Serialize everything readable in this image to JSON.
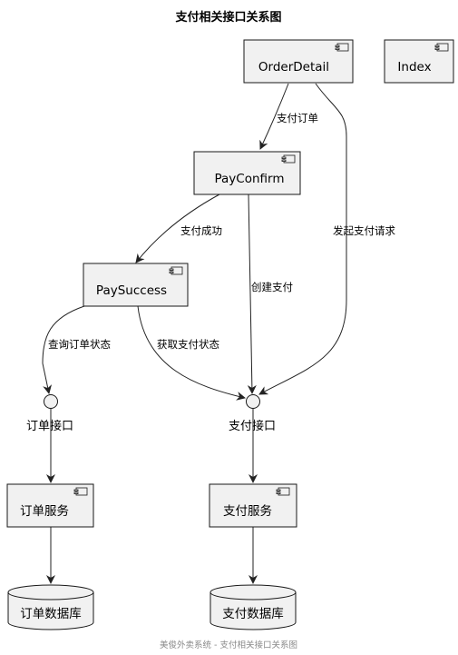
{
  "title": "支付相关接口关系图",
  "footer": "美俊外卖系统 - 支付相关接口关系图",
  "nodes": {
    "order_detail": "OrderDetail",
    "index": "Index",
    "pay_confirm": "PayConfirm",
    "pay_success": "PaySuccess",
    "order_service": "订单服务",
    "pay_service": "支付服务"
  },
  "interfaces": {
    "order_api": "订单接口",
    "pay_api": "支付接口"
  },
  "databases": {
    "order_db": "订单数据库",
    "pay_db": "支付数据库"
  },
  "edges": {
    "detail_to_confirm": "支付订单",
    "confirm_to_success": "支付成功",
    "detail_to_payapi": "发起支付请求",
    "confirm_to_payapi": "创建支付",
    "success_to_orderapi": "查询订单状态",
    "success_to_payapi": "获取支付状态"
  }
}
